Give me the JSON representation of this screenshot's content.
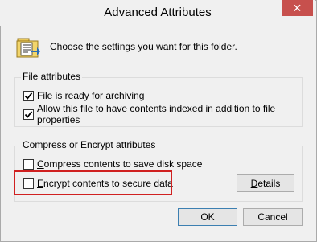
{
  "window": {
    "title": "Advanced Attributes",
    "close_glyph": "✕"
  },
  "intro": {
    "text": "Choose the settings you want for this folder."
  },
  "file_attributes": {
    "title": "File attributes",
    "archive": {
      "label_prefix": "File is ready for ",
      "label_accel": "a",
      "label_suffix": "rchiving",
      "checked": true
    },
    "indexed": {
      "label_prefix": "Allow this file to have contents ",
      "label_accel": "i",
      "label_suffix": "ndexed in addition to file properties",
      "checked": true
    }
  },
  "compress_encrypt": {
    "title": "Compress or Encrypt attributes",
    "compress": {
      "label_accel": "C",
      "label_suffix": "ompress contents to save disk space",
      "checked": false
    },
    "encrypt": {
      "label_accel": "E",
      "label_suffix": "ncrypt contents to secure data",
      "checked": false
    },
    "details_button": {
      "label_accel": "D",
      "label_suffix": "etails"
    }
  },
  "buttons": {
    "ok": "OK",
    "cancel": "Cancel"
  },
  "colors": {
    "highlight": "#d02020",
    "close_button": "#c7504d",
    "default_button_border": "#3c7fb1"
  }
}
